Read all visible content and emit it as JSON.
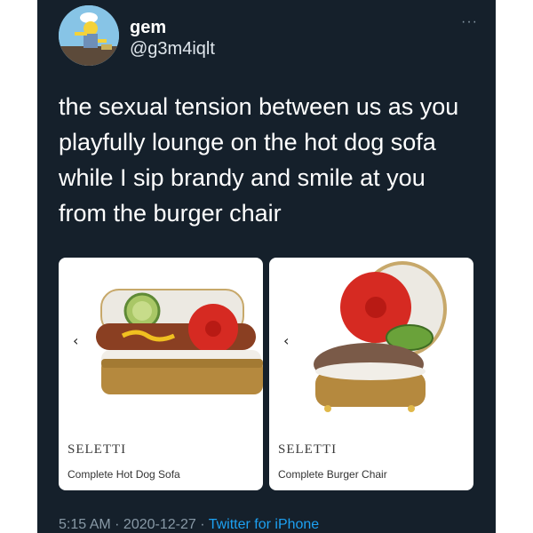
{
  "tweet": {
    "display_name": "gem",
    "handle": "@g3m4iqlt",
    "more_icon": "···",
    "text": "the sexual tension between us as you playfully lounge on the hot dog sofa while I sip brandy and smile at you from the burger chair"
  },
  "media": [
    {
      "brand": "SELETTI",
      "name": "Complete Hot Dog Sofa",
      "chevron": "‹"
    },
    {
      "brand": "SELETTI",
      "name": "Complete Burger Chair",
      "chevron": "‹"
    }
  ],
  "meta": {
    "time": "5:15 AM",
    "separator": " · ",
    "date": "2020-12-27",
    "source": "Twitter for iPhone"
  },
  "colors": {
    "background": "#15202b",
    "link": "#1da1f2",
    "secondary_text": "#8899a6"
  }
}
